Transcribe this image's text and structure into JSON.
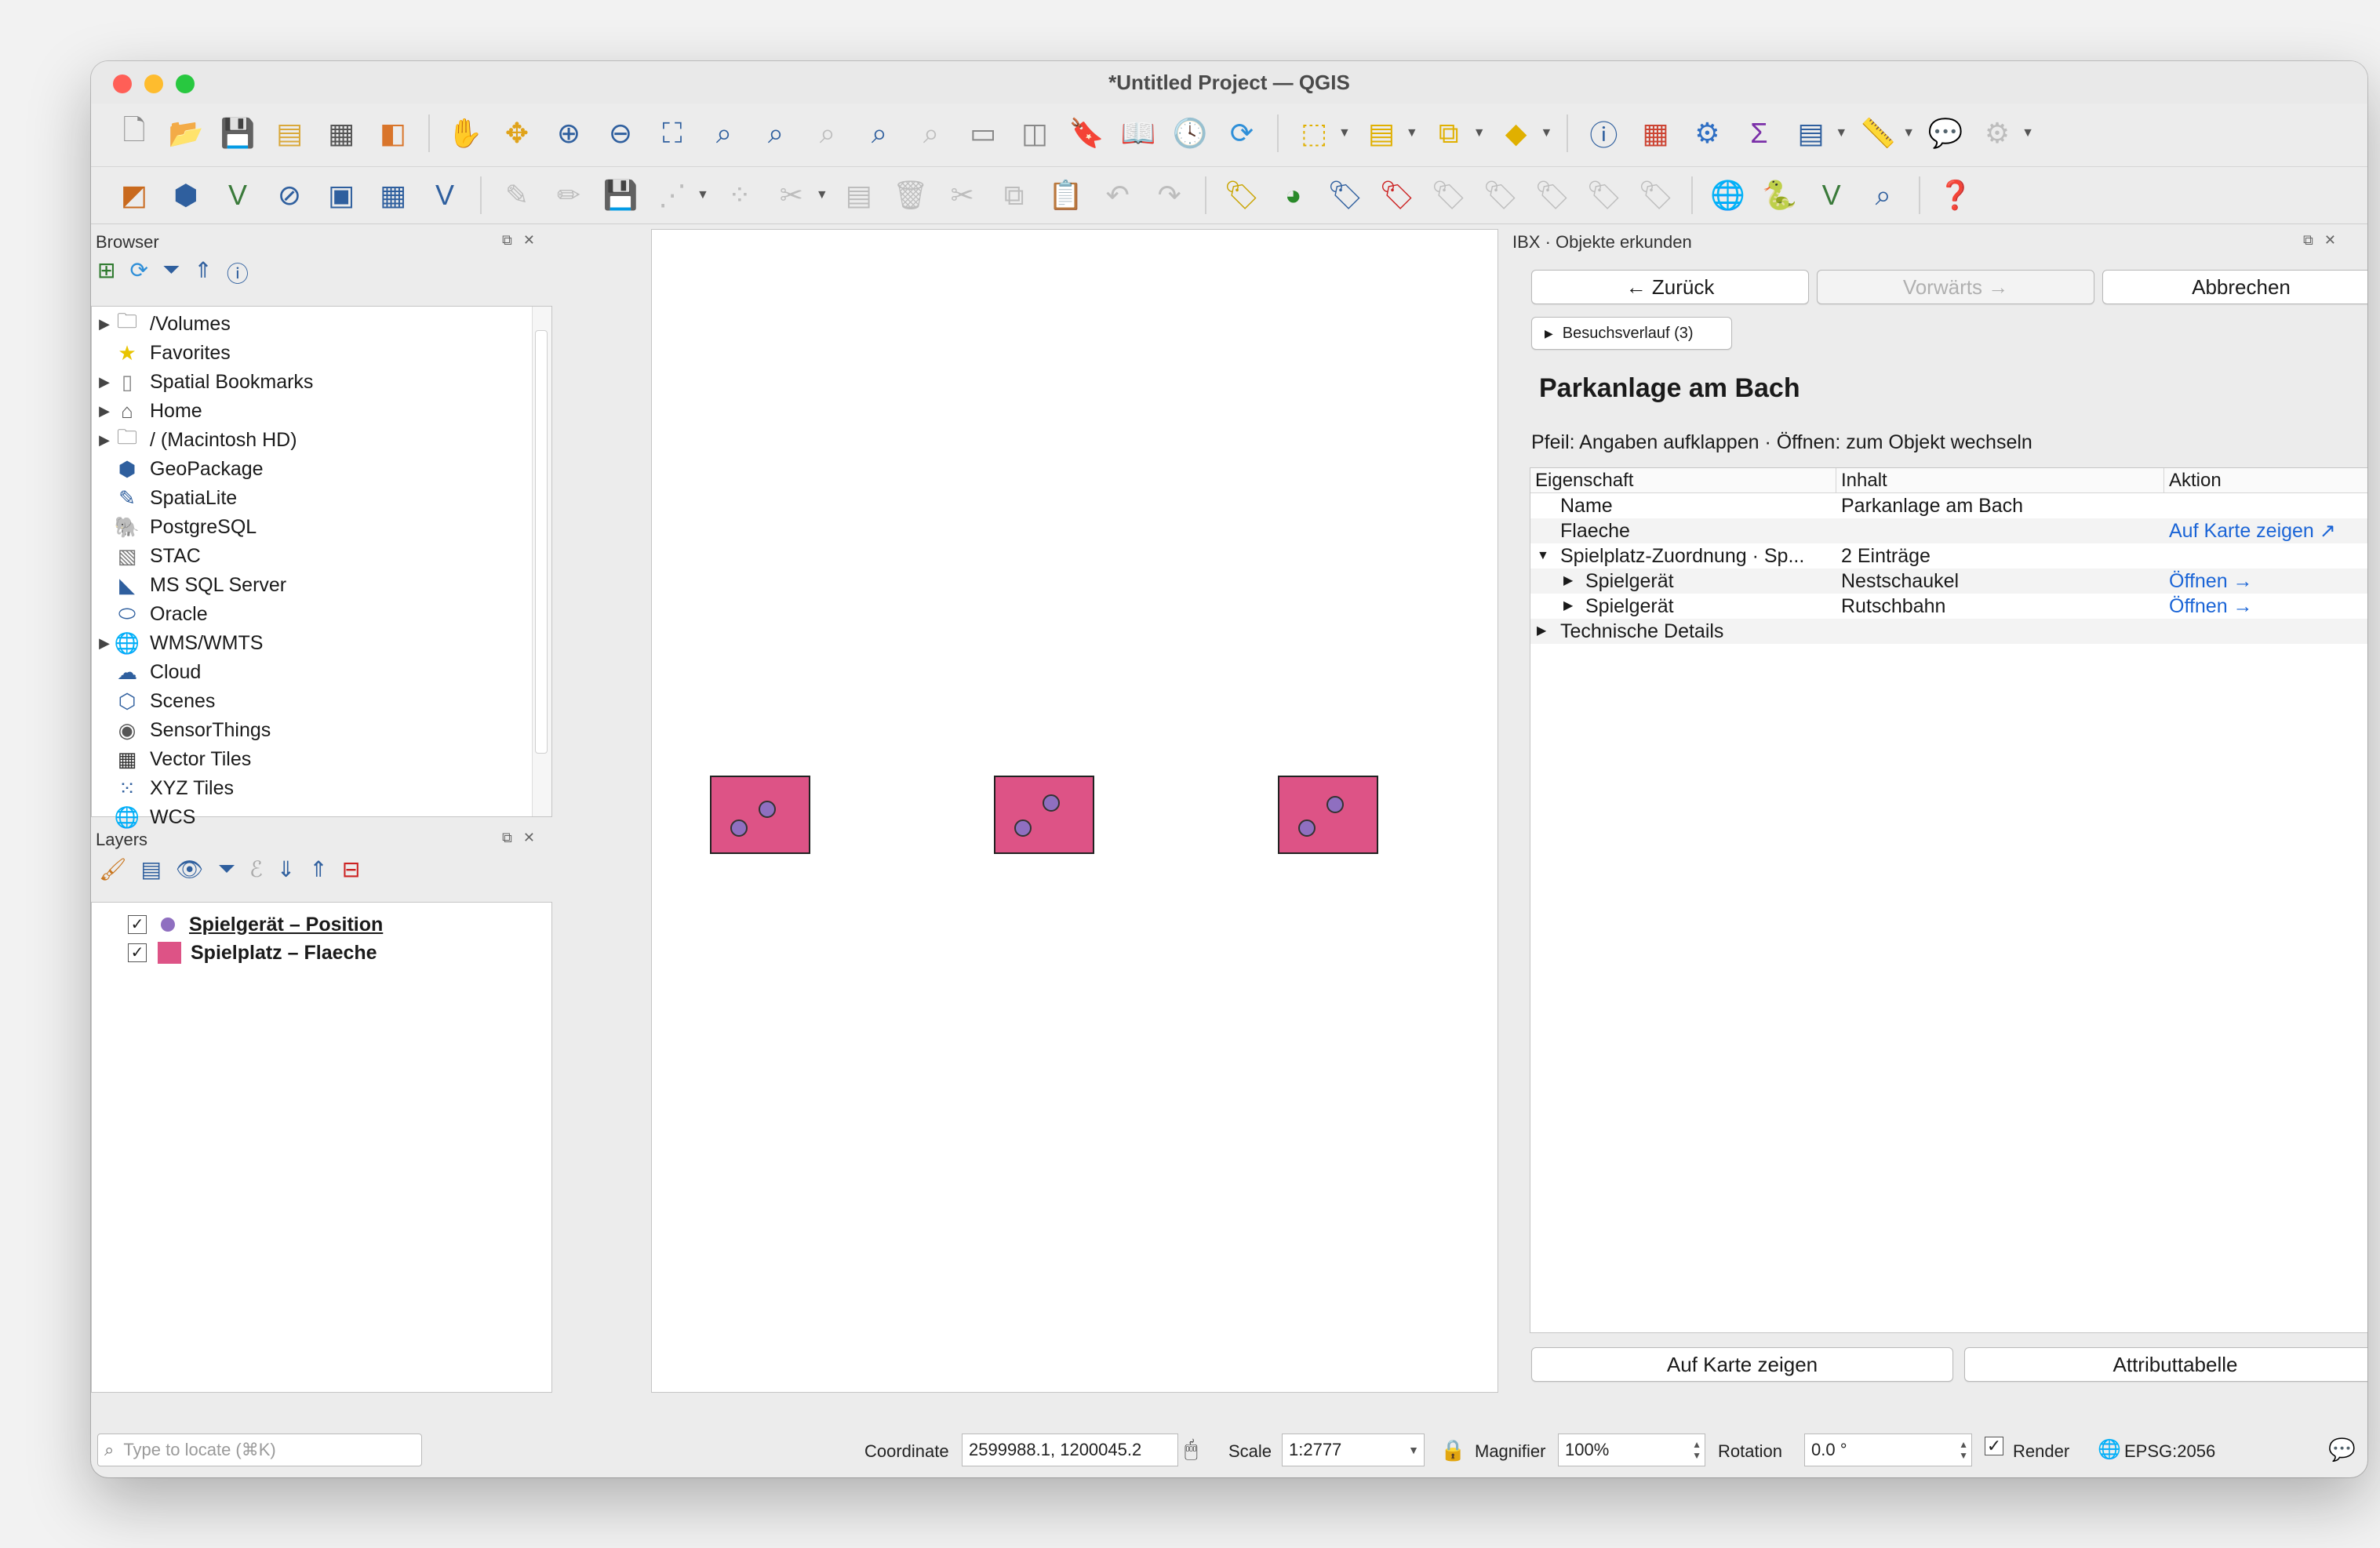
{
  "window": {
    "title": "*Untitled Project — QGIS"
  },
  "browser": {
    "title": "Browser",
    "items": [
      {
        "label": "/Volumes",
        "icon": "folder-icon",
        "expandable": true
      },
      {
        "label": "Favorites",
        "icon": "star-icon",
        "expandable": false
      },
      {
        "label": "Spatial Bookmarks",
        "icon": "bookmark-icon",
        "expandable": true
      },
      {
        "label": "Home",
        "icon": "home-icon",
        "expandable": true
      },
      {
        "label": "/ (Macintosh HD)",
        "icon": "folder-icon",
        "expandable": true
      },
      {
        "label": "GeoPackage",
        "icon": "geopackage-icon",
        "expandable": false
      },
      {
        "label": "SpatiaLite",
        "icon": "spatialite-icon",
        "expandable": false
      },
      {
        "label": "PostgreSQL",
        "icon": "postgresql-icon",
        "expandable": false
      },
      {
        "label": "STAC",
        "icon": "stac-icon",
        "expandable": false
      },
      {
        "label": "MS SQL Server",
        "icon": "mssql-icon",
        "expandable": false
      },
      {
        "label": "Oracle",
        "icon": "oracle-icon",
        "expandable": false
      },
      {
        "label": "WMS/WMTS",
        "icon": "globe-icon",
        "expandable": true
      },
      {
        "label": "Cloud",
        "icon": "cloud-icon",
        "expandable": false
      },
      {
        "label": "Scenes",
        "icon": "scenes-icon",
        "expandable": false
      },
      {
        "label": "SensorThings",
        "icon": "sensor-icon",
        "expandable": false
      },
      {
        "label": "Vector Tiles",
        "icon": "grid-icon",
        "expandable": false
      },
      {
        "label": "XYZ Tiles",
        "icon": "tiles-icon",
        "expandable": false
      },
      {
        "label": "WCS",
        "icon": "globe-icon",
        "expandable": false
      }
    ]
  },
  "layers": {
    "title": "Layers",
    "items": [
      {
        "label": "Spielgerät – Position",
        "symbol": "point",
        "color": "#8f6fc0"
      },
      {
        "label": "Spielplatz – Flaeche",
        "symbol": "polygon",
        "color": "#dd5386"
      }
    ]
  },
  "ibx": {
    "title": "IBX · Objekte erkunden",
    "back_label": "← Zurück",
    "forward_label": "Vorwärts →",
    "cancel_label": "Abbrechen",
    "history_label": "Besuchsverlauf (3)",
    "heading": "Parkanlage am Bach",
    "hint": "Pfeil: Angaben aufklappen · Öffnen: zum Objekt wechseln",
    "columns": [
      "Eigenschaft",
      "Inhalt",
      "Aktion"
    ],
    "rows": [
      {
        "prop": "Name",
        "value": "Parkanlage am Bach",
        "action": ""
      },
      {
        "prop": "Flaeche",
        "value": "",
        "action": "Auf Karte zeigen ↗"
      },
      {
        "prop": "Spielplatz-Zuordnung · Sp...",
        "value": "2 Einträge",
        "action": ""
      },
      {
        "prop": "Spielgerät",
        "value": "Nestschaukel",
        "action": "Öffnen →"
      },
      {
        "prop": "Spielgerät",
        "value": "Rutschbahn",
        "action": "Öffnen →"
      },
      {
        "prop": "Technische Details",
        "value": "",
        "action": ""
      }
    ],
    "show_on_map_label": "Auf Karte zeigen",
    "attribute_table_label": "Attributtabelle"
  },
  "status": {
    "locate_placeholder": "Type to locate (⌘K)",
    "coordinate_label": "Coordinate",
    "coordinate_value": "2599988.1, 1200045.2",
    "scale_label": "Scale",
    "scale_value": "1:2777",
    "magnifier_label": "Magnifier",
    "magnifier_value": "100%",
    "rotation_label": "Rotation",
    "rotation_value": "0.0 °",
    "render_label": "Render",
    "crs_label": "EPSG:2056"
  },
  "colors": {
    "polygon_fill": "#dd5386",
    "point_fill": "#8f6fc0",
    "link": "#1a64d6"
  }
}
